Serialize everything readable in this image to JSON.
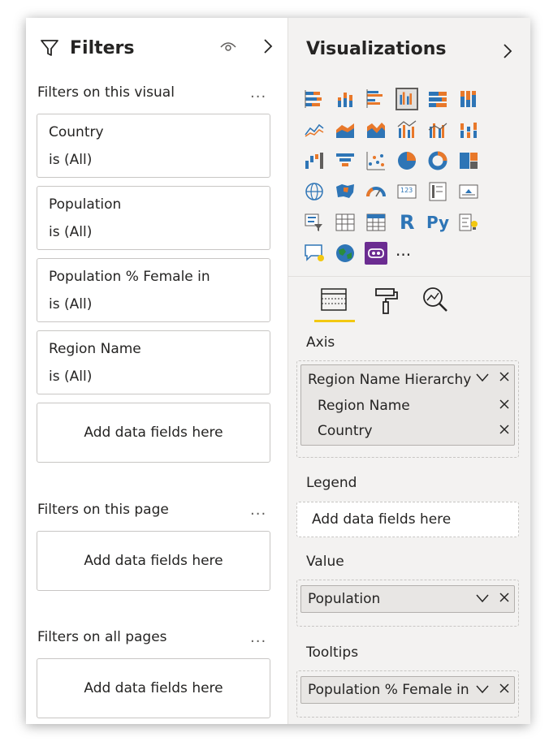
{
  "filters": {
    "title": "Filters",
    "sections": {
      "visual": {
        "label": "Filters on this visual",
        "more": "..."
      },
      "page": {
        "label": "Filters on this page",
        "more": "..."
      },
      "all": {
        "label": "Filters on all pages",
        "more": "..."
      }
    },
    "cards": [
      {
        "name": "Country",
        "condition": "is (All)"
      },
      {
        "name": "Population",
        "condition": "is (All)"
      },
      {
        "name": "Population % Female in",
        "condition": "is (All)"
      },
      {
        "name": "Region Name",
        "condition": "is (All)"
      }
    ],
    "drop_placeholder": "Add data fields here"
  },
  "visualizations": {
    "title": "Visualizations",
    "more_visuals": "...",
    "r_label": "R",
    "py_label": "Py",
    "card_label": "123",
    "wells": {
      "axis": {
        "label": "Axis",
        "hierarchy": "Region Name Hierarchy",
        "items": [
          "Region Name",
          "Country"
        ]
      },
      "legend": {
        "label": "Legend",
        "placeholder": "Add data fields here"
      },
      "value": {
        "label": "Value",
        "field": "Population"
      },
      "tooltips": {
        "label": "Tooltips",
        "field": "Population % Female in"
      }
    }
  },
  "colors": {
    "accent_yellow": "#f2c811",
    "icon_blue": "#2e75b6",
    "icon_orange": "#e8782a",
    "selected_purple": "#6b2c91"
  }
}
